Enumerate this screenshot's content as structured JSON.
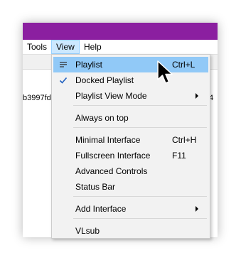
{
  "menubar": {
    "tools": "Tools",
    "view": "View",
    "help": "Help"
  },
  "background": {
    "left_text": "b3997fd",
    "right_text": "4"
  },
  "view_menu": {
    "items": [
      {
        "label": "Playlist",
        "shortcut": "Ctrl+L",
        "icon": "list-icon",
        "highlighted": true
      },
      {
        "label": "Docked Playlist",
        "shortcut": "",
        "icon": "checkmark-icon"
      },
      {
        "label": "Playlist View Mode",
        "shortcut": "",
        "submenu": true
      },
      {
        "label": "Always on top",
        "shortcut": ""
      },
      {
        "label": "Minimal Interface",
        "shortcut": "Ctrl+H"
      },
      {
        "label": "Fullscreen Interface",
        "shortcut": "F11"
      },
      {
        "label": "Advanced Controls",
        "shortcut": ""
      },
      {
        "label": "Status Bar",
        "shortcut": ""
      },
      {
        "label": "Add Interface",
        "shortcut": "",
        "submenu": true
      },
      {
        "label": "VLsub",
        "shortcut": ""
      }
    ]
  },
  "colors": {
    "title_bar": "#8b1fa0",
    "highlight": "#91c9f7",
    "menu_background": "#f2f2f2"
  }
}
